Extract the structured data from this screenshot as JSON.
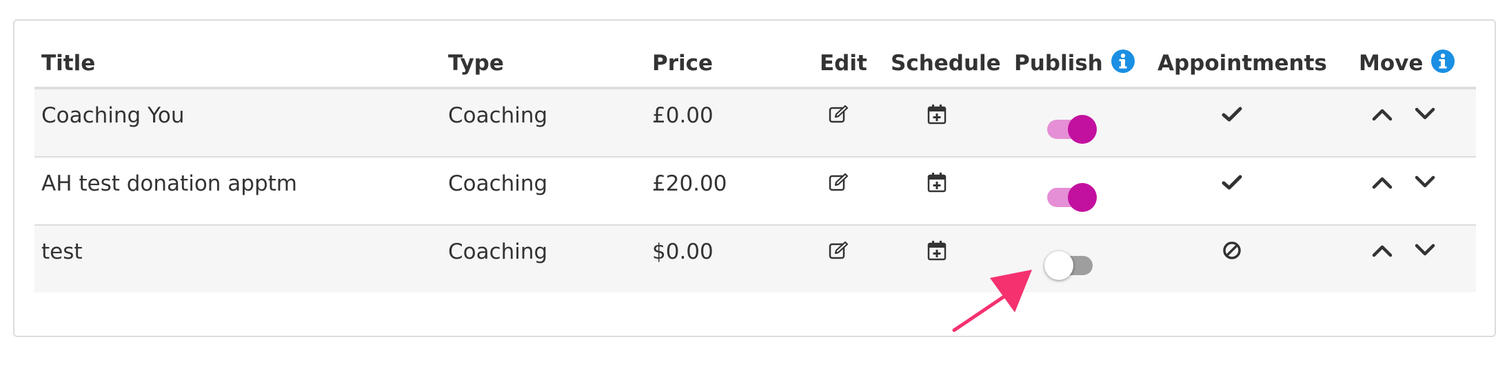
{
  "table": {
    "headers": {
      "title": "Title",
      "type": "Type",
      "price": "Price",
      "edit": "Edit",
      "schedule": "Schedule",
      "publish": "Publish",
      "appointments": "Appointments",
      "move": "Move"
    },
    "rows": [
      {
        "title": "Coaching You",
        "type": "Coaching",
        "price": "£0.00",
        "published": true,
        "appointments": "check-icon"
      },
      {
        "title": "AH test donation apptm",
        "type": "Coaching",
        "price": "£20.00",
        "published": true,
        "appointments": "check-icon"
      },
      {
        "title": "test",
        "type": "Coaching",
        "price": "$0.00",
        "published": false,
        "appointments": "ban-icon"
      }
    ]
  },
  "colors": {
    "toggle_on": "#c2119f",
    "toggle_on_track": "#e58fd6",
    "toggle_off_track": "#9e9e9e",
    "info_icon": "#1a8fe3",
    "annotation_arrow": "#f5316f"
  }
}
